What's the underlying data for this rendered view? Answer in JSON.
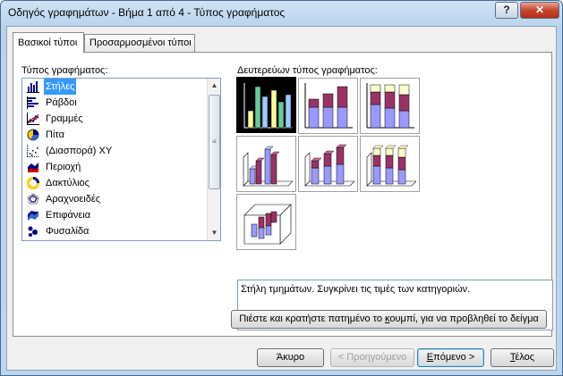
{
  "window": {
    "title": "Οδηγός γραφημάτων - Βήμα 1 από 4 - Τύπος γραφήματος",
    "help_label": "?",
    "close_label": "✕"
  },
  "tabs": [
    {
      "label": "Βασικοί τύποι",
      "active": true
    },
    {
      "label": "Προσαρμοσμένοι τύποι",
      "active": false
    }
  ],
  "chart_type_label": "Τύπος γραφήματος:",
  "chart_types": [
    {
      "label": "Στήλες",
      "icon": "column-chart-icon",
      "selected": true
    },
    {
      "label": "Ράβδοι",
      "icon": "bar-chart-icon"
    },
    {
      "label": "Γραμμές",
      "icon": "line-chart-icon"
    },
    {
      "label": "Πίτα",
      "icon": "pie-chart-icon"
    },
    {
      "label": "(Διασπορά) XY",
      "icon": "scatter-chart-icon"
    },
    {
      "label": "Περιοχή",
      "icon": "area-chart-icon"
    },
    {
      "label": "Δακτύλιος",
      "icon": "doughnut-chart-icon"
    },
    {
      "label": "Αραχνοειδές",
      "icon": "radar-chart-icon"
    },
    {
      "label": "Επιφάνεια",
      "icon": "surface-chart-icon"
    },
    {
      "label": "Φυσαλίδα",
      "icon": "bubble-chart-icon"
    }
  ],
  "subtype_label": "Δευτερεύων τύπος γραφήματος:",
  "description": "Στήλη τμημάτων. Συγκρίνει τις τιμές των κατηγοριών.",
  "preview_button": {
    "before": "Πιέστε και κρατήστε πατημένο το ",
    "underlined": "κ",
    "after": "ουμπί, για να προβληθεί το δείγμα"
  },
  "buttons": {
    "cancel": "Άκυρο",
    "back": "< Προηγούμενο",
    "next_underlined": "Ε",
    "next_rest": "πόμενο >",
    "finish_underlined": "Τ",
    "finish_rest": "έλος"
  },
  "colors": {
    "series1": "#9999ff",
    "series2": "#993366",
    "series3": "#ffffcc",
    "selected_series1": "#ffff99",
    "selected_series2": "#66cc99",
    "selected_series3": "#99ccff"
  }
}
